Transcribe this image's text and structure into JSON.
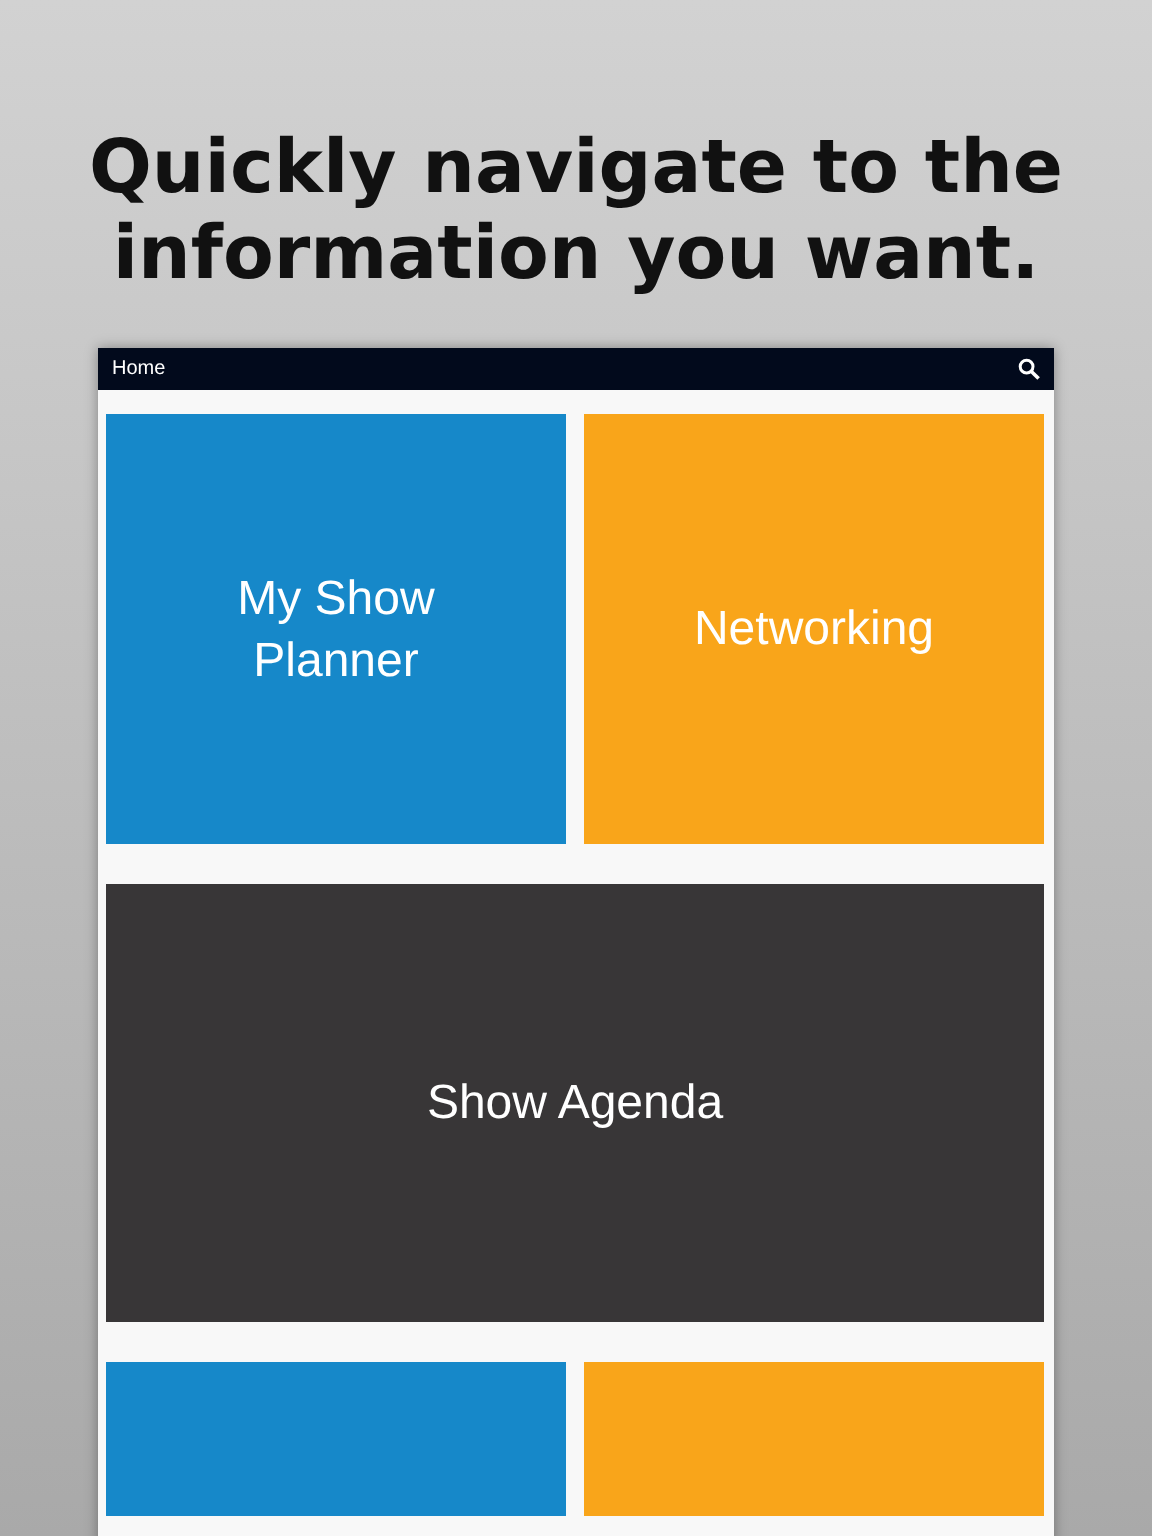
{
  "headline": "Quickly navigate to the information you want.",
  "app": {
    "title": "Home",
    "tiles": [
      {
        "label": "My Show Planner",
        "color": "#1688c9",
        "wide": false
      },
      {
        "label": "Networking",
        "color": "#f9a51a",
        "wide": false
      },
      {
        "label": "Show Agenda",
        "color": "#383637",
        "wide": true
      },
      {
        "color": "#1688c9",
        "wide": false
      },
      {
        "color": "#f9a51a",
        "wide": false
      }
    ]
  }
}
